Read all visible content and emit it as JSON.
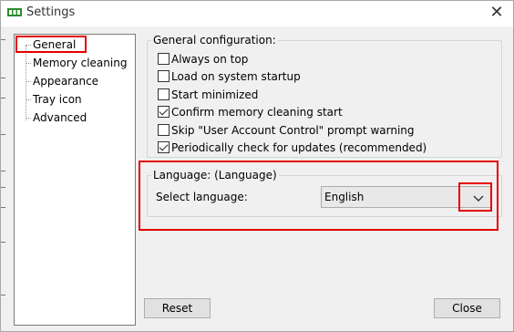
{
  "window": {
    "title": "Settings"
  },
  "icons": {
    "app": "memory-chip-icon",
    "close": "close-icon",
    "dropdown": "chevron-down-icon"
  },
  "colors": {
    "highlight": "#e50000",
    "background": "#f0f0f0"
  },
  "sidebar": {
    "items": [
      {
        "label": "General",
        "selected": true
      },
      {
        "label": "Memory cleaning"
      },
      {
        "label": "Appearance"
      },
      {
        "label": "Tray icon"
      },
      {
        "label": "Advanced"
      }
    ]
  },
  "general": {
    "title": "General configuration:",
    "options": [
      {
        "label": "Always on top",
        "checked": false
      },
      {
        "label": "Load on system startup",
        "checked": false
      },
      {
        "label": "Start minimized",
        "checked": false
      },
      {
        "label": "Confirm memory cleaning start",
        "checked": true
      },
      {
        "label": "Skip \"User Account Control\" prompt warning",
        "checked": false
      },
      {
        "label": "Periodically check for updates (recommended)",
        "checked": true
      }
    ]
  },
  "language": {
    "title": "Language: (Language)",
    "select_label": "Select language:",
    "selected": "English"
  },
  "buttons": {
    "reset": "Reset",
    "close": "Close"
  }
}
